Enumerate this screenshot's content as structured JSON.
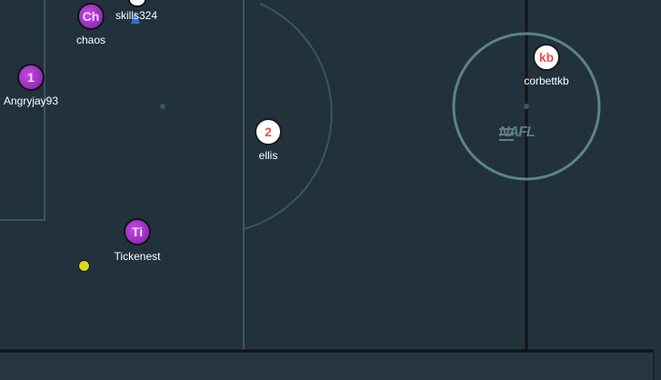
{
  "colors": {
    "pitch": "#22323d",
    "line": "#3b5563",
    "center_ring": "#5a858b",
    "team_home": "#9a2fbf",
    "team_away": "#ffffff",
    "away_number": "#ef4d4d",
    "ball": "#d8d81c"
  },
  "logo": {
    "text": "NAFL"
  },
  "players": [
    {
      "id": "chaos",
      "badge": "Ch",
      "name": "chaos",
      "team": "home"
    },
    {
      "id": "skills324",
      "badge": "",
      "name": "skills324",
      "team": "unknown"
    },
    {
      "id": "angryjay93",
      "badge": "1",
      "name": "Angryjay93",
      "team": "home"
    },
    {
      "id": "tickenest",
      "badge": "Ti",
      "name": "Tickenest",
      "team": "home"
    },
    {
      "id": "ellis",
      "badge": "2",
      "name": "ellis",
      "team": "away"
    },
    {
      "id": "corbettkb",
      "badge": "kb",
      "name": "corbettkb",
      "team": "away"
    }
  ]
}
